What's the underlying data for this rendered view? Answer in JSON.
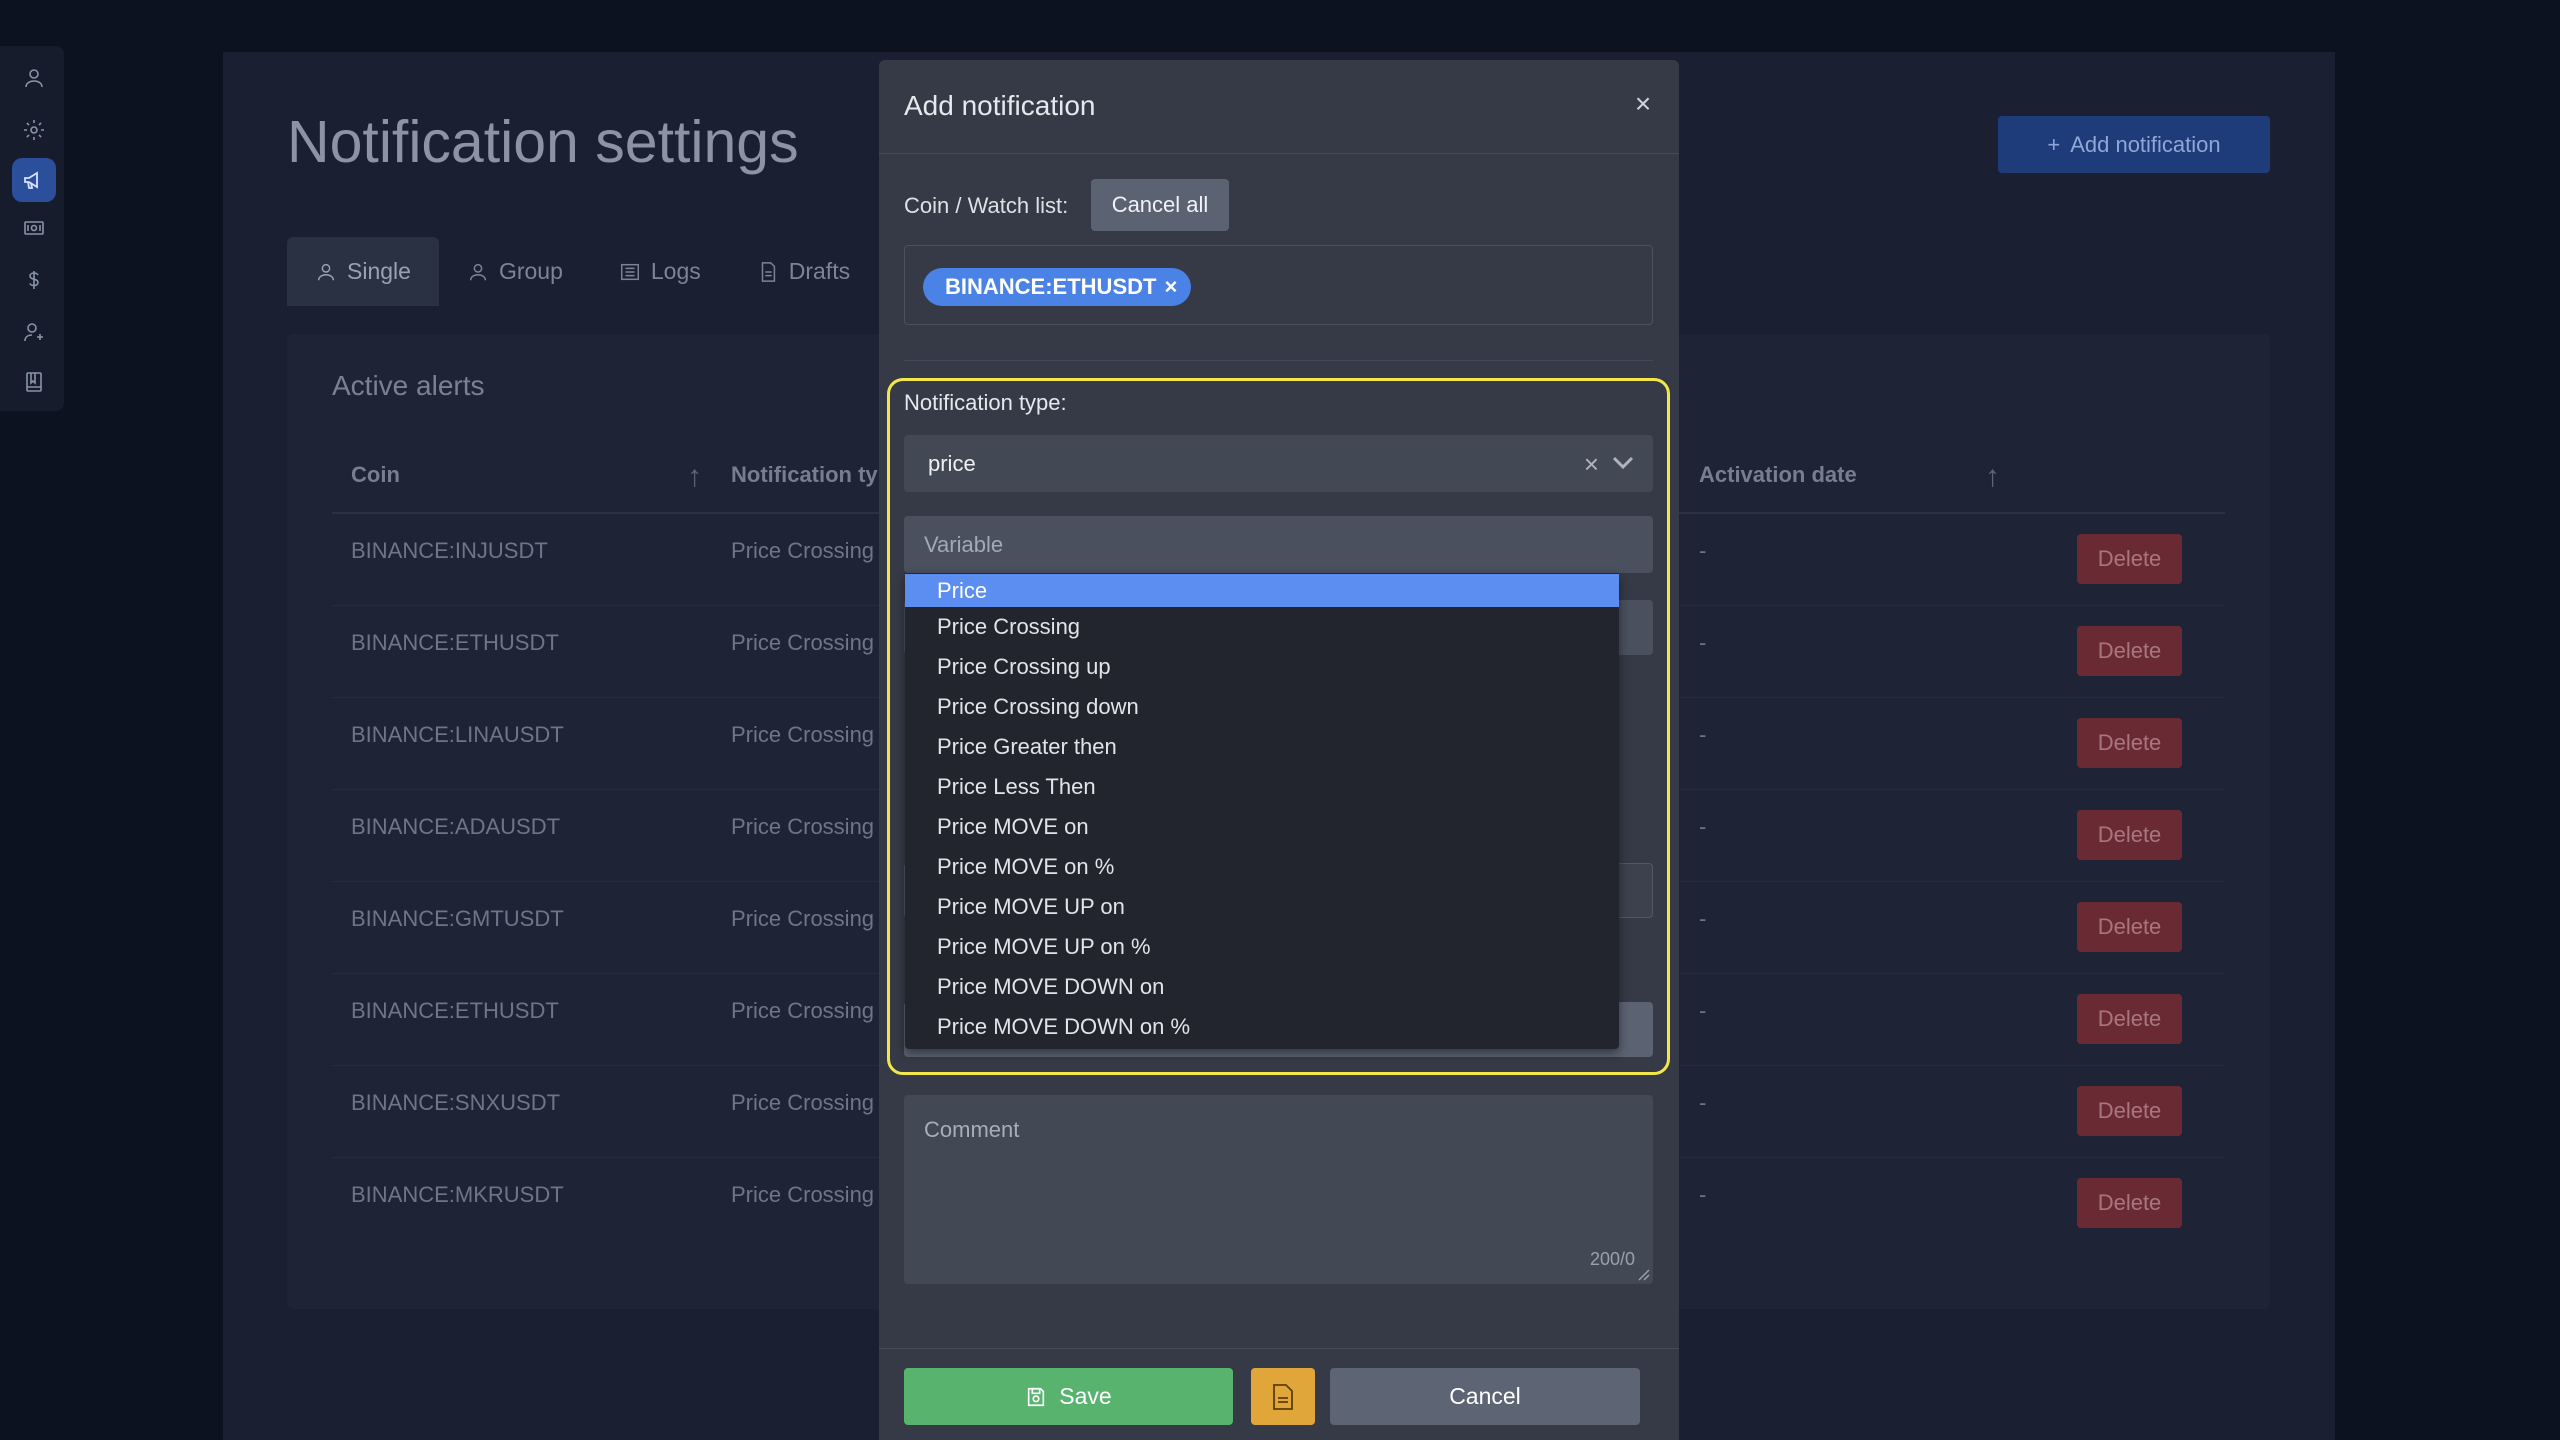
{
  "page": {
    "title": "Notification settings",
    "add_button": "Add notification"
  },
  "tabs": [
    {
      "label": "Single"
    },
    {
      "label": "Group"
    },
    {
      "label": "Logs"
    },
    {
      "label": "Drafts"
    }
  ],
  "alerts": {
    "title": "Active alerts",
    "headers": {
      "coin": "Coin",
      "type": "Notification ty",
      "activation": "Activation date"
    },
    "rows": [
      {
        "coin": "BINANCE:INJUSDT",
        "type": "Price Crossing",
        "activation": "-"
      },
      {
        "coin": "BINANCE:ETHUSDT",
        "type": "Price Crossing",
        "activation": "-"
      },
      {
        "coin": "BINANCE:LINAUSDT",
        "type": "Price Crossing",
        "activation": "-"
      },
      {
        "coin": "BINANCE:ADAUSDT",
        "type": "Price Crossing",
        "activation": "-"
      },
      {
        "coin": "BINANCE:GMTUSDT",
        "type": "Price Crossing",
        "activation": "-"
      },
      {
        "coin": "BINANCE:ETHUSDT",
        "type": "Price Crossing",
        "activation": "-"
      },
      {
        "coin": "BINANCE:SNXUSDT",
        "type": "Price Crossing",
        "activation": "-"
      },
      {
        "coin": "BINANCE:MKRUSDT",
        "type": "Price Crossing",
        "activation": "-"
      }
    ],
    "delete_label": "Delete"
  },
  "modal": {
    "title": "Add notification",
    "coin_label": "Coin / Watch list:",
    "cancel_all": "Cancel all",
    "chip": "BINANCE:ETHUSDT",
    "notification_type_label": "Notification type:",
    "type_value": "price",
    "variable_placeholder": "Variable",
    "options": [
      "Price",
      "Price Crossing",
      "Price Crossing up",
      "Price Crossing down",
      "Price Greater then",
      "Price Less Then",
      "Price MOVE on",
      "Price MOVE on %",
      "Price MOVE UP on",
      "Price MOVE UP on %",
      "Price MOVE DOWN on",
      "Price MOVE DOWN on %"
    ],
    "comment_placeholder": "Comment",
    "comment_counter": "200/0",
    "save": "Save",
    "cancel": "Cancel"
  },
  "colors": {
    "accent": "#5b8ef0",
    "highlight": "#f1e64a",
    "save": "#58b36e",
    "draft": "#e0a63a",
    "delete": "#6a2a34"
  }
}
